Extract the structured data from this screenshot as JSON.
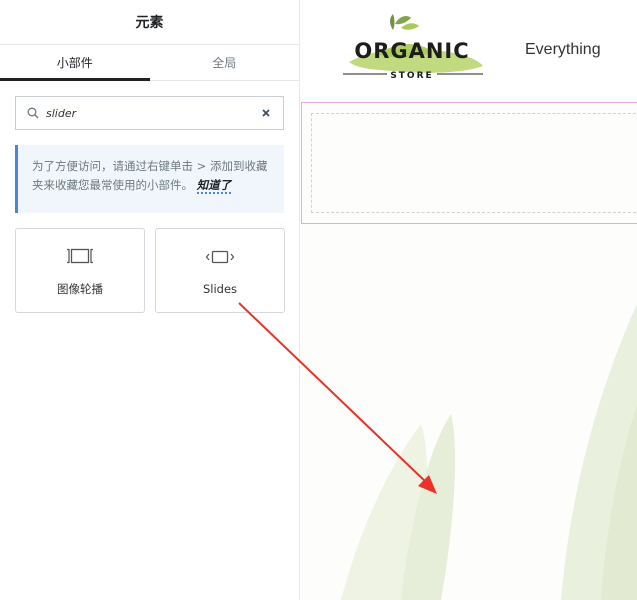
{
  "panel": {
    "title": "元素",
    "tabs": [
      {
        "label": "小部件",
        "active": true
      },
      {
        "label": "全局",
        "active": false
      }
    ],
    "search": {
      "value": "slider",
      "placeholder": ""
    },
    "notice": {
      "text": "为了方便访问，请通过右键单击 > 添加到收藏夹来收藏您最常使用的小部件。",
      "link": "知道了"
    },
    "widgets": [
      {
        "label": "图像轮播",
        "icon": "image-carousel-icon"
      },
      {
        "label": "Slides",
        "icon": "slides-icon"
      }
    ]
  },
  "preview": {
    "logo": {
      "main": "ORGANIC",
      "sub": "STORE"
    },
    "nav": {
      "item": "Everything"
    }
  },
  "colors": {
    "accent_blue": "#4f84d3",
    "section_outline": "#e5a9e5",
    "logo_green": "#a8c95a",
    "arrow_red": "#e8322a"
  }
}
